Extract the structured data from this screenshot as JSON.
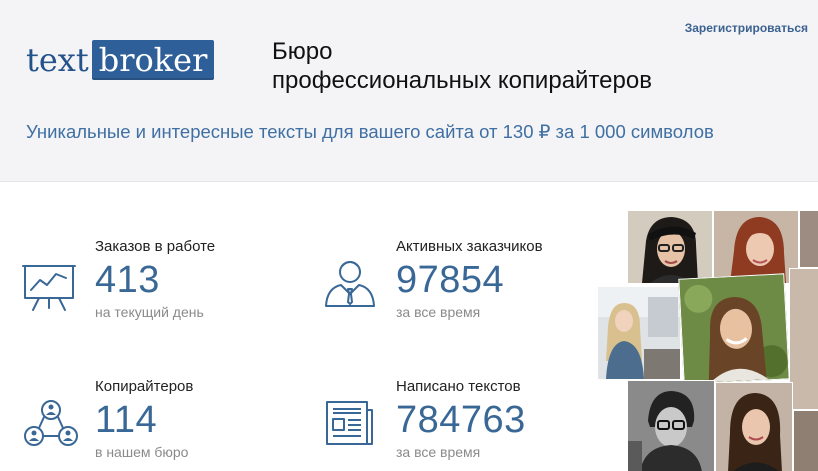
{
  "header": {
    "logo": {
      "left": "text",
      "right": "broker"
    },
    "title_line1": "Бюро",
    "title_line2": "профессиональных копирайтеров",
    "register_link": "Зарегистрироваться",
    "tagline": "Уникальные и интересные тексты для вашего сайта от 130 ₽ за 1 000 символов"
  },
  "stats": {
    "orders": {
      "label": "Заказов в работе",
      "value": "413",
      "sub": "на текущий день",
      "icon": "presentation-chart-icon"
    },
    "clients": {
      "label": "Активных заказчиков",
      "value": "97854",
      "sub": "за все время",
      "icon": "client-person-icon"
    },
    "writers": {
      "label": "Копирайтеров",
      "value": "114",
      "sub": "в нашем бюро",
      "icon": "team-network-icon"
    },
    "texts": {
      "label": "Написано текстов",
      "value": "784763",
      "sub": "за все время",
      "icon": "newspaper-icon"
    }
  },
  "colors": {
    "accent": "#3a6896",
    "header_bg": "#f4f4f6",
    "logo_blue": "#2f5f98"
  }
}
